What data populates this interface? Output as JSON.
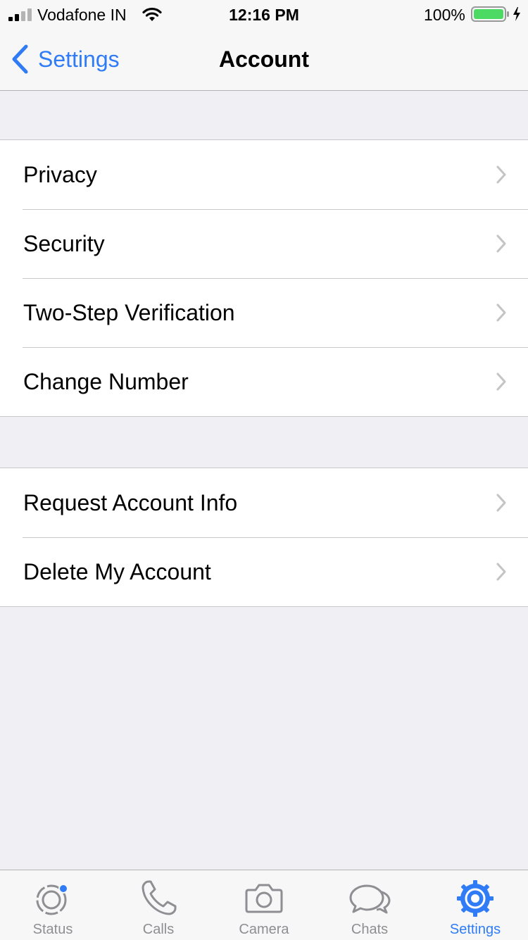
{
  "status_bar": {
    "carrier": "Vodafone IN",
    "time": "12:16 PM",
    "battery": "100%"
  },
  "nav": {
    "back_label": "Settings",
    "title": "Account"
  },
  "groups": [
    {
      "items": [
        {
          "label": "Privacy"
        },
        {
          "label": "Security"
        },
        {
          "label": "Two-Step Verification"
        },
        {
          "label": "Change Number"
        }
      ]
    },
    {
      "items": [
        {
          "label": "Request Account Info"
        },
        {
          "label": "Delete My Account"
        }
      ]
    }
  ],
  "tabs": [
    {
      "label": "Status",
      "icon": "status-icon"
    },
    {
      "label": "Calls",
      "icon": "phone-icon"
    },
    {
      "label": "Camera",
      "icon": "camera-icon"
    },
    {
      "label": "Chats",
      "icon": "chats-icon"
    },
    {
      "label": "Settings",
      "icon": "gear-icon",
      "active": true
    }
  ],
  "colors": {
    "accent": "#2f7cf6",
    "background": "#efeff4",
    "battery": "#4cd964",
    "inactive": "#8e8e93"
  }
}
